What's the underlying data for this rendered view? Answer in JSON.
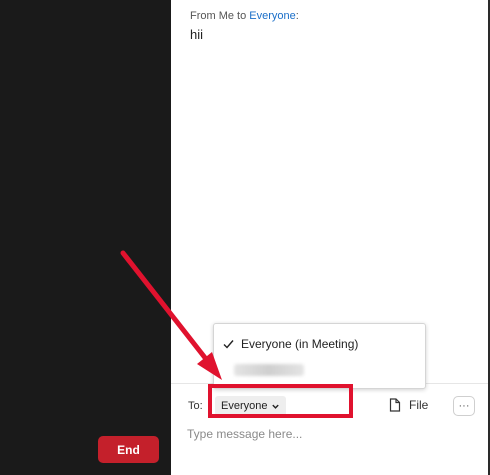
{
  "chat": {
    "message": {
      "header_prefix": "From Me to ",
      "header_recipient": "Everyone",
      "header_suffix": ":",
      "text": "hii"
    },
    "composer": {
      "to_label": "To:",
      "recipient_value": "Everyone",
      "file_label": "File",
      "more_label": "···",
      "input_placeholder": "Type message here..."
    },
    "recipient_dropdown": {
      "options": [
        {
          "label": "Everyone (in Meeting)",
          "selected": true
        },
        {
          "label": "",
          "redacted": true
        }
      ]
    }
  },
  "meeting": {
    "end_label": "End"
  },
  "colors": {
    "end_button": "#c4202b",
    "link_blue": "#1a6ec8",
    "annotation_red": "#e0122e",
    "dark_bg": "#1a1a1a"
  }
}
